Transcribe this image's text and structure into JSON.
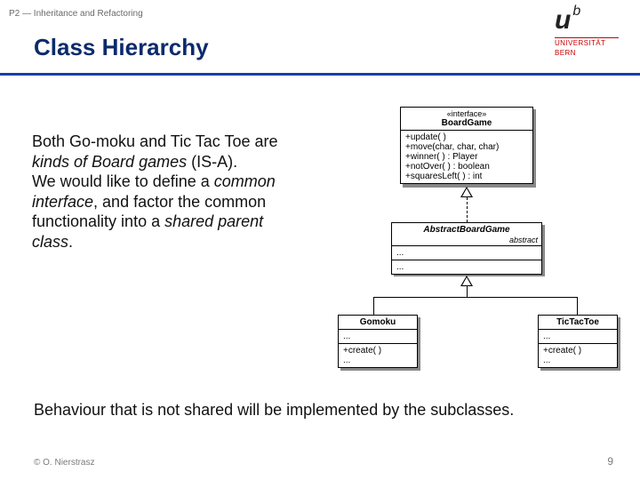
{
  "breadcrumb": "P2 — Inheritance and Refactoring",
  "title": "Class Hierarchy",
  "logo": {
    "u": "u",
    "b": "b",
    "line1": "UNIVERSITÄT",
    "line2": "BERN"
  },
  "body": {
    "p1a": "Both Go-moku and Tic Tac Toe are ",
    "p1b": "kinds of Board games",
    "p1c": " (IS-A).",
    "p2a": "We would like to define a ",
    "p2b": "common interface",
    "p2c": ", and factor the common functionality into a ",
    "p2d": "shared parent class",
    "p2e": "."
  },
  "bottom": "Behaviour that is not shared will be implemented by the subclasses.",
  "footer": {
    "left": "© O. Nierstrasz",
    "right": "9"
  },
  "uml": {
    "interface": {
      "stereo": "«interface»",
      "name": "BoardGame",
      "ops": [
        "+update( )",
        "+move(char, char, char)",
        "+winner( ) : Player",
        "+notOver( ) : boolean",
        "+squaresLeft( ) : int"
      ]
    },
    "abstract": {
      "name": "AbstractBoardGame",
      "tag": "abstract",
      "attrs": "...",
      "ops": "..."
    },
    "gomoku": {
      "name": "Gomoku",
      "attrs": "...",
      "ops1": "+create( )",
      "ops2": "..."
    },
    "tictactoe": {
      "name": "TicTacToe",
      "attrs": "...",
      "ops1": "+create( )",
      "ops2": "..."
    }
  }
}
